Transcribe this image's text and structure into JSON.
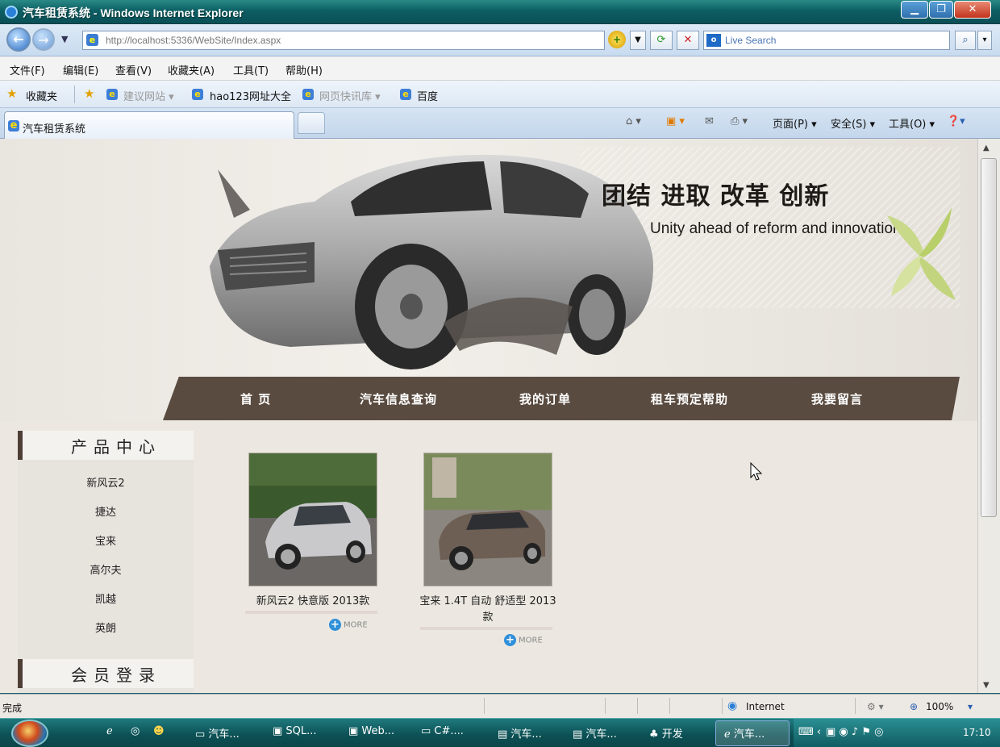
{
  "window": {
    "title": "汽车租赁系统 - Windows Internet Explorer"
  },
  "address_bar": {
    "url": "http://localhost:5336/WebSite/Index.aspx",
    "search_placeholder": "Live Search"
  },
  "menu": [
    "文件(F)",
    "编辑(E)",
    "查看(V)",
    "收藏夹(A)",
    "工具(T)",
    "帮助(H)"
  ],
  "favorites": {
    "label": "收藏夹",
    "links": [
      "建议网站 ▾",
      "hao123网址大全",
      "网页快讯库 ▾",
      "百度"
    ]
  },
  "tab": {
    "title": "汽车租赁系统"
  },
  "command_bar": {
    "page": "页面(P) ▾",
    "safety": "安全(S) ▾",
    "tools": "工具(O) ▾"
  },
  "banner": {
    "slogan_cn": "团结 进取 改革 创新",
    "slogan_en": "Unity ahead of reform and innovation"
  },
  "nav": [
    "首 页",
    "汽车信息查询",
    "我的订单",
    "租车预定帮助",
    "我要留言"
  ],
  "sidebar": {
    "product_heading": "产品中心",
    "products": [
      "新风云2",
      "捷达",
      "宝来",
      "高尔夫",
      "凯越",
      "英朗"
    ],
    "login_heading": "会员登录"
  },
  "products": [
    {
      "name": "新风云2 快意版 2013款",
      "more": "MORE"
    },
    {
      "name": "宝来 1.4T 自动 舒适型 2013款",
      "more": "MORE"
    }
  ],
  "status_bar": {
    "text": "完成",
    "zone": "Internet",
    "zoom": "100%"
  },
  "taskbar": {
    "items": [
      "汽车...",
      "SQL...",
      "Web...",
      "C#....",
      "汽车...",
      "汽车...",
      "开发",
      "汽车..."
    ],
    "clock": "17:10"
  },
  "colors": {
    "nav_bg": "#5a4b40",
    "page_bg": "#ece8e1",
    "titlebar": "#0d5f64"
  }
}
